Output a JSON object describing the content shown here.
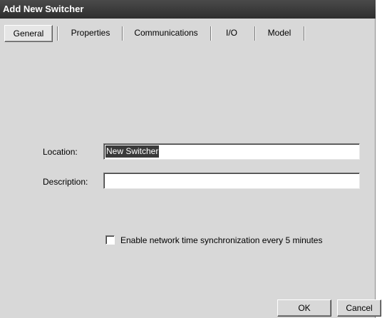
{
  "window": {
    "title": "Add New Switcher"
  },
  "tabs": [
    {
      "label": "General",
      "active": true
    },
    {
      "label": "Properties",
      "active": false
    },
    {
      "label": "Communications",
      "active": false
    },
    {
      "label": "I/O",
      "active": false
    },
    {
      "label": "Model",
      "active": false
    }
  ],
  "form": {
    "location_label": "Location:",
    "location_value": "New Switcher",
    "description_label": "Description:",
    "description_value": "",
    "sync_checkbox_label": "Enable network time synchronization every 5 minutes",
    "sync_checked": false
  },
  "buttons": {
    "ok_label": "OK",
    "cancel_label": "Cancel"
  },
  "colors": {
    "dialog_bg": "#d8d8d8",
    "titlebar_bg": "#3a3a3a",
    "selection_bg": "#3a3a3a"
  }
}
